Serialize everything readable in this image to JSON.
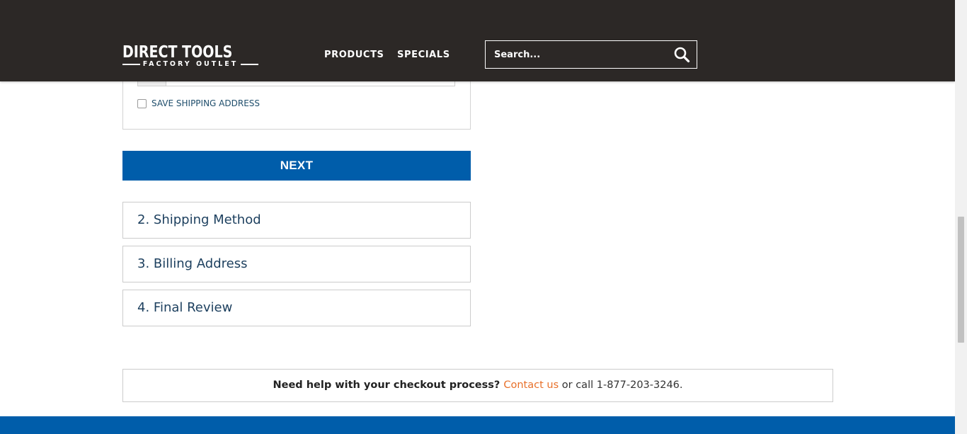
{
  "header": {
    "logo_main": "DIRECT TOOLS",
    "logo_sub": "FACTORY OUTLET",
    "nav": {
      "products": "PRODUCTS",
      "specials": "SPECIALS"
    },
    "search": {
      "placeholder": "Search..."
    }
  },
  "checkout": {
    "save_shipping_label": "SAVE SHIPPING ADDRESS",
    "next_label": "NEXT",
    "steps": [
      {
        "label": "2. Shipping Method"
      },
      {
        "label": "3. Billing Address"
      },
      {
        "label": "4. Final Review"
      }
    ]
  },
  "help": {
    "question": "Need help with your checkout process?",
    "contact_link": "Contact us",
    "call_text": "or call 1-877-203-3246."
  },
  "colors": {
    "header_bg": "#2c2826",
    "primary_blue": "#005daa",
    "link_orange": "#e8702a",
    "step_text": "#1c3f5e"
  },
  "icons": {
    "search": "search-icon"
  }
}
